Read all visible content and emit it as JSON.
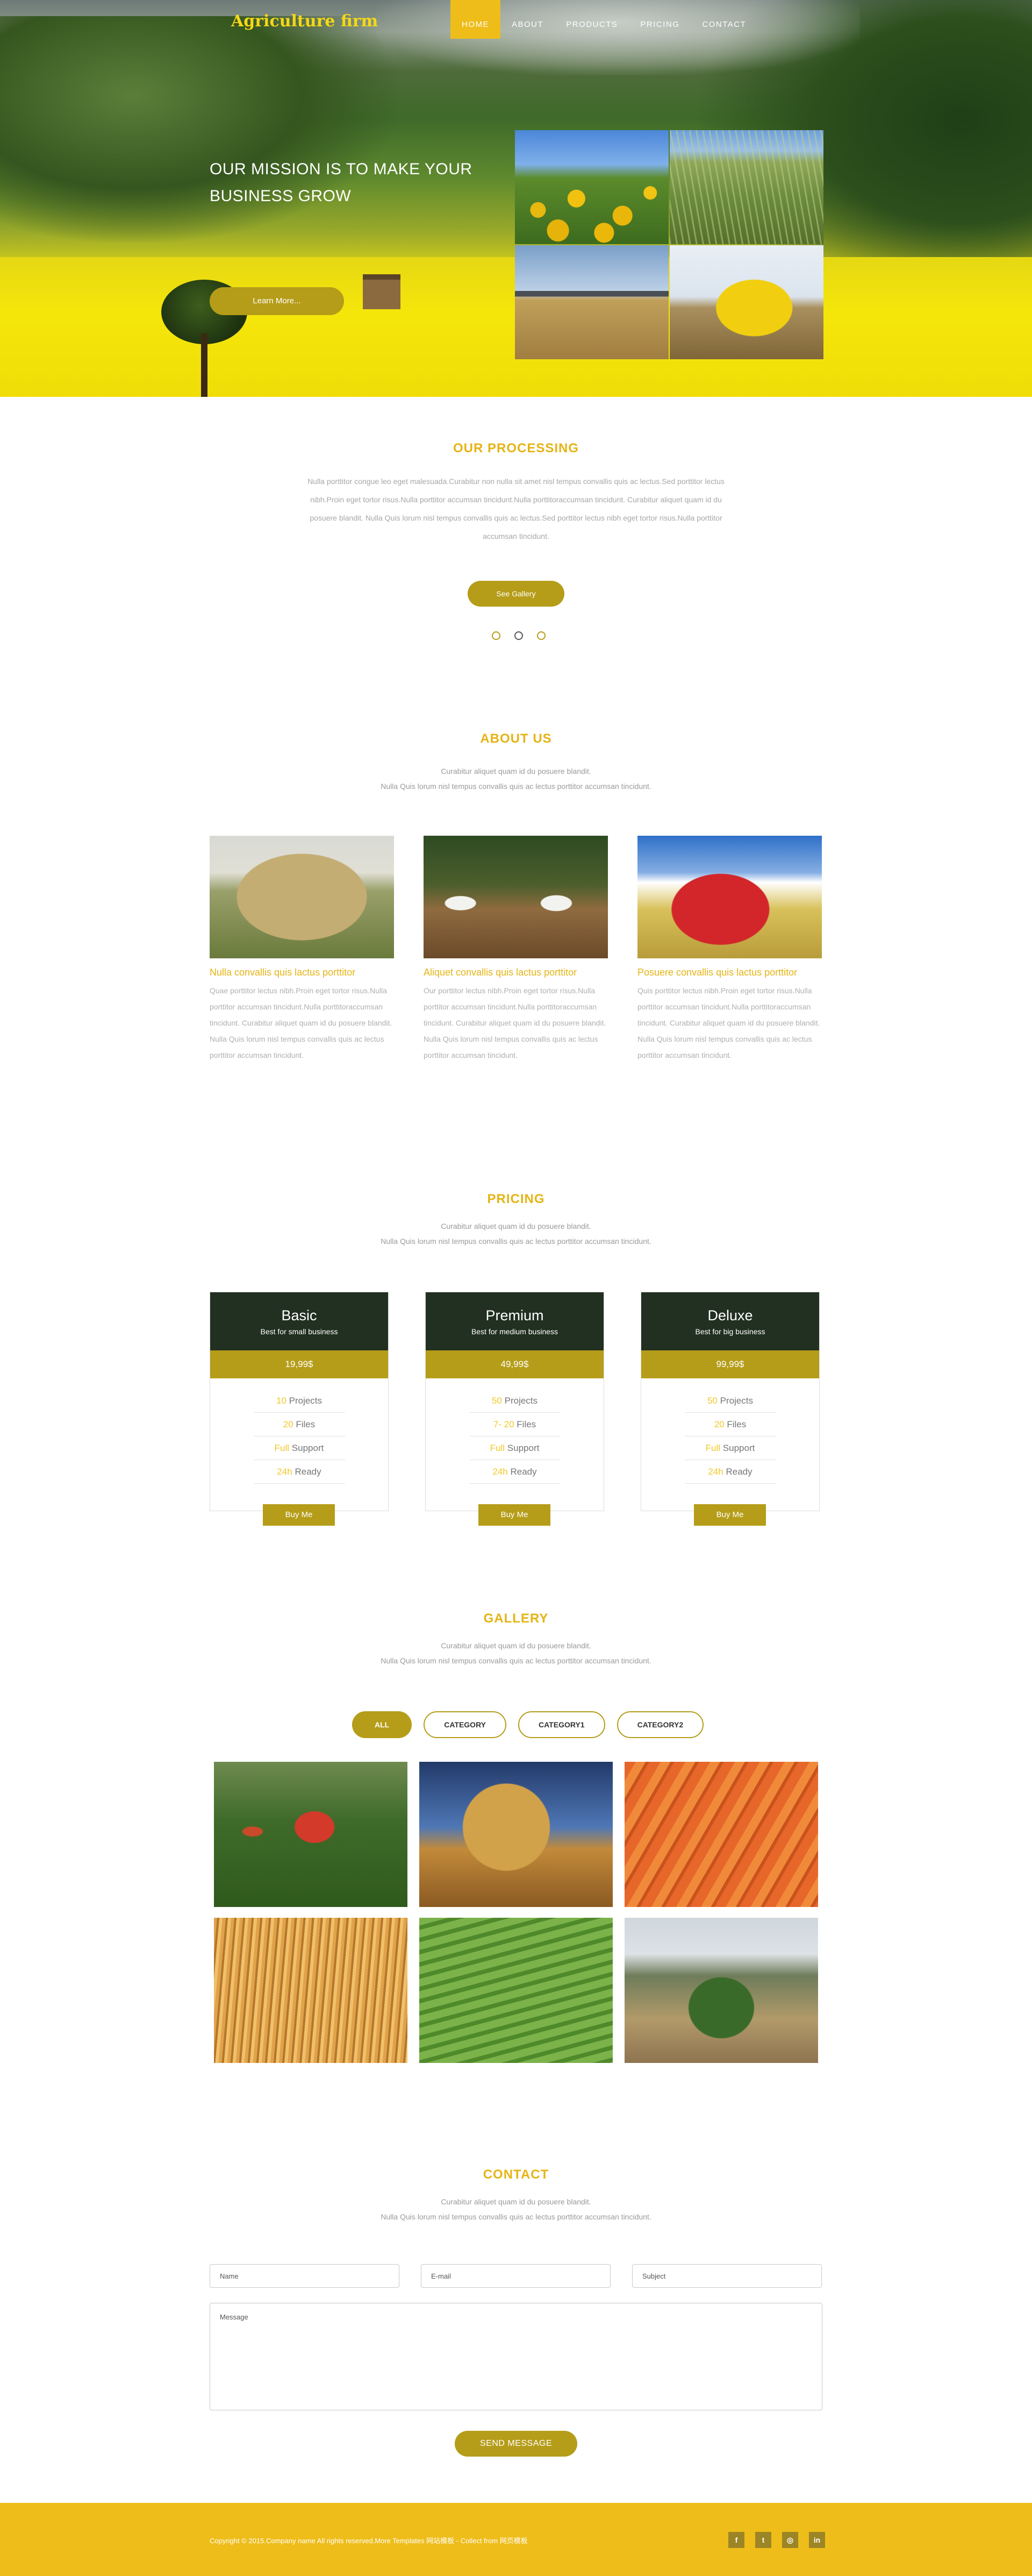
{
  "brand": "Agriculture firm",
  "nav": [
    "HOME",
    "ABOUT",
    "PRODUCTS",
    "PRICING",
    "CONTACT"
  ],
  "hero": {
    "heading_line1": "OUR MISSION IS TO MAKE YOUR",
    "heading_line2": "BUSINESS GROW",
    "button": "Learn More..."
  },
  "processing": {
    "title": "OUR PROCESSING",
    "text": "Nulla porttitor congue leo eget malesuada.Curabitur non nulla sit amet nisl tempus convallis quis ac lectus.Sed porttitor lectus nibh.Proin eget tortor risus.Nulla porttitor accumsan tincidunt.Nulla porttitoraccumsan tincidunt. Curabitur aliquet quam id du posuere blandit. Nulla Quis lorum nisl tempus convallis quis ac lectus.Sed porttitor lectus nibh eget tortor risus.Nulla porttitor accumsan tincidunt.",
    "button": "See Gallery"
  },
  "about": {
    "title": "ABOUT US",
    "sub1": "Curabitur aliquet quam id du posuere blandit.",
    "sub2": "Nulla Quis lorum nisl tempus convallis quis ac lectus porttitor accumsan tincidunt.",
    "cards": [
      {
        "title": "Nulla convallis quis lactus porttitor",
        "text": "Quae porttitor lectus nibh.Proin eget tortor risus.Nulla porttitor accumsan tincidunt.Nulla porttitoraccumsan tincidunt. Curabitur aliquet quam id du posuere blandit. Nulla Quis lorum nisl tempus convallis quis ac lectus porttitor accumsan tincidunt."
      },
      {
        "title": "Aliquet convallis quis lactus porttitor",
        "text": "Our porttitor lectus nibh.Proin eget tortor risus.Nulla porttitor accumsan tincidunt.Nulla porttitoraccumsan tincidunt. Curabitur aliquet quam id du posuere blandit. Nulla Quis lorum nisl tempus convallis quis ac lectus porttitor accumsan tincidunt."
      },
      {
        "title": "Posuere convallis quis lactus porttitor",
        "text": "Quis porttitor lectus nibh.Proin eget tortor risus.Nulla porttitor accumsan tincidunt.Nulla porttitoraccumsan tincidunt. Curabitur aliquet quam id du posuere blandit. Nulla Quis lorum nisl tempus convallis quis ac lectus porttitor accumsan tincidunt."
      }
    ]
  },
  "pricing": {
    "title": "PRICING",
    "sub1": "Curabitur aliquet quam id du posuere blandit.",
    "sub2": "Nulla Quis lorum nisl tempus convallis quis ac lectus porttitor accumsan tincidunt.",
    "plans": [
      {
        "name": "Basic",
        "desc": "Best for small business",
        "price": "19,99$",
        "features": [
          [
            "10",
            " Projects"
          ],
          [
            "20",
            " Files"
          ],
          [
            "Full",
            " Support"
          ],
          [
            "24h",
            " Ready"
          ]
        ],
        "button": "Buy Me"
      },
      {
        "name": "Premium",
        "desc": "Best for medium business",
        "price": "49,99$",
        "features": [
          [
            "50",
            " Projects"
          ],
          [
            "7- 20",
            " Files"
          ],
          [
            "Full",
            " Support"
          ],
          [
            "24h",
            " Ready"
          ]
        ],
        "button": "Buy Me"
      },
      {
        "name": "Deluxe",
        "desc": "Best for big business",
        "price": "99,99$",
        "features": [
          [
            "50",
            " Projects"
          ],
          [
            "20",
            " Files"
          ],
          [
            "Full",
            " Support"
          ],
          [
            "24h",
            " Ready"
          ]
        ],
        "button": "Buy Me"
      }
    ]
  },
  "gallery": {
    "title": "GALLERY",
    "sub1": "Curabitur aliquet quam id du posuere blandit.",
    "sub2": "Nulla Quis lorum nisl tempus convallis quis ac lectus porttitor accumsan tincidunt.",
    "filters": [
      "ALL",
      "CATEGORY",
      "CATEGORY1",
      "CATEGORY2"
    ]
  },
  "contact": {
    "title": "CONTACT",
    "sub1": "Curabitur aliquet quam id du posuere blandit.",
    "sub2": "Nulla Quis lorum nisl tempus convallis quis ac lectus porttitor accumsan tincidunt.",
    "name_placeholder": "Name",
    "email_placeholder": "E-mail",
    "subject_placeholder": "Subject",
    "message_placeholder": "Message",
    "send": "SEND MESSAGE"
  },
  "footer": {
    "copyright": "Copyright © 2015.Company name All rights reserved.More Templates 网站模板 - Collect from 网页模板",
    "social": [
      "f",
      "t",
      "◎",
      "in"
    ]
  },
  "colors": {
    "accent": "#eebd1a",
    "button": "#b59d19",
    "dark": "#213020",
    "title": "#e5b415"
  }
}
